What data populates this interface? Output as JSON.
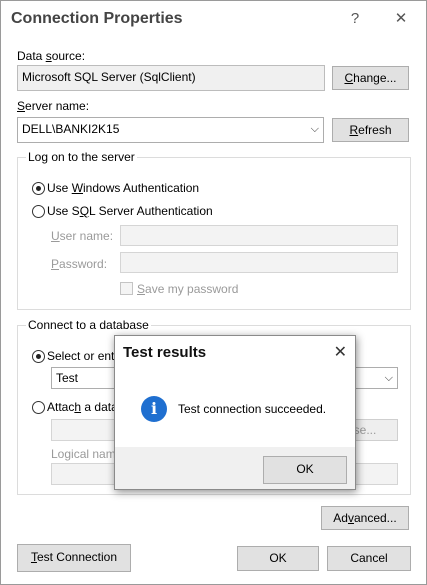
{
  "window": {
    "title": "Connection Properties",
    "help_glyph": "?",
    "close_glyph": "✕"
  },
  "data_source": {
    "label_pre": "Data ",
    "label_accel": "s",
    "label_post": "ource:",
    "value": "Microsoft SQL Server (SqlClient)",
    "change_button_accel": "C",
    "change_button_rest": "hange..."
  },
  "server": {
    "label_accel": "S",
    "label_rest": "erver name:",
    "value": "DELL\\BANKI2K15",
    "refresh_button_accel": "R",
    "refresh_button_rest": "efresh"
  },
  "logon_group": {
    "title": "Log on to the server",
    "windows_auth_pre": "Use ",
    "windows_auth_accel": "W",
    "windows_auth_post": "indows Authentication",
    "windows_auth_selected": true,
    "sql_auth_pre": "Use S",
    "sql_auth_accel": "Q",
    "sql_auth_post": "L Server Authentication",
    "sql_auth_selected": false,
    "username_accel": "U",
    "username_rest": "ser name:",
    "username_value": "",
    "password_accel": "P",
    "password_rest": "assword:",
    "password_value": "",
    "save_password_accel": "S",
    "save_password_rest": "ave my password",
    "save_password_checked": false
  },
  "database_group": {
    "title": "Connect to a database",
    "select_db_label": "Select or ente",
    "select_db_selected": true,
    "db_value": "Test",
    "attach_label_pre": "Attac",
    "attach_label_accel": "h",
    "attach_label_post": " a data",
    "attach_selected": false,
    "browse_button_partial": "se...",
    "logical_name_label": "Logical nam"
  },
  "footer": {
    "advanced_pre": "Ad",
    "advanced_accel": "v",
    "advanced_post": "anced...",
    "test_connection_accel": "T",
    "test_connection_rest": "est Connection",
    "ok_label": "OK",
    "cancel_label": "Cancel"
  },
  "test_results_dialog": {
    "title": "Test results",
    "close_glyph": "✕",
    "icon": "info-icon",
    "icon_glyph": "i",
    "message": "Test connection succeeded.",
    "ok_label": "OK"
  },
  "colors": {
    "highlight": "#d21e2f",
    "info_icon": "#1f6fd0"
  }
}
